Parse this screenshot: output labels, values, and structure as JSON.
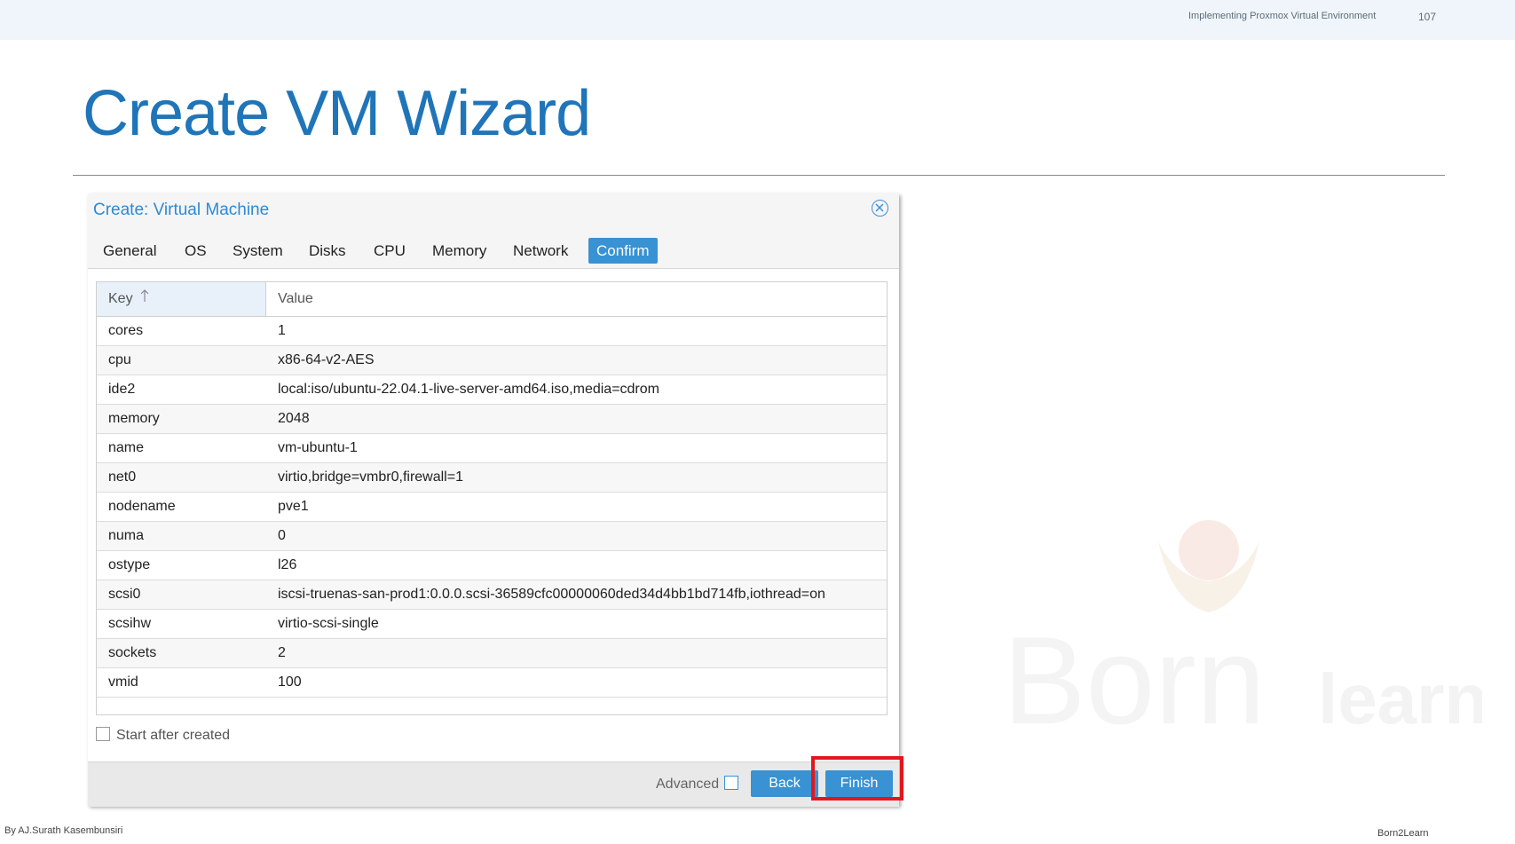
{
  "slide": {
    "header_text": "Implementing Proxmox Virtual Environment",
    "page_number": "107",
    "title": "Create VM Wizard",
    "footer_left": "By AJ.Surath Kasembunsiri",
    "footer_right": "Born2Learn",
    "watermark_text_1": "Born",
    "watermark_text_2": "learn"
  },
  "dialog": {
    "title": "Create: Virtual Machine",
    "close_icon": "close-circle-icon",
    "tabs": [
      {
        "label": "General"
      },
      {
        "label": "OS"
      },
      {
        "label": "System"
      },
      {
        "label": "Disks"
      },
      {
        "label": "CPU"
      },
      {
        "label": "Memory"
      },
      {
        "label": "Network"
      },
      {
        "label": "Confirm"
      }
    ],
    "active_tab": "Confirm",
    "grid": {
      "key_header": "Key",
      "sort_icon": "sort-ascending-icon",
      "value_header": "Value",
      "rows": [
        {
          "key": "cores",
          "value": "1"
        },
        {
          "key": "cpu",
          "value": "x86-64-v2-AES"
        },
        {
          "key": "ide2",
          "value": "local:iso/ubuntu-22.04.1-live-server-amd64.iso,media=cdrom"
        },
        {
          "key": "memory",
          "value": "2048"
        },
        {
          "key": "name",
          "value": "vm-ubuntu-1"
        },
        {
          "key": "net0",
          "value": "virtio,bridge=vmbr0,firewall=1"
        },
        {
          "key": "nodename",
          "value": "pve1"
        },
        {
          "key": "numa",
          "value": "0"
        },
        {
          "key": "ostype",
          "value": "l26"
        },
        {
          "key": "scsi0",
          "value": "iscsi-truenas-san-prod1:0.0.0.scsi-36589cfc00000060ded34d4bb1bd714fb,iothread=on"
        },
        {
          "key": "scsihw",
          "value": "virtio-scsi-single"
        },
        {
          "key": "sockets",
          "value": "2"
        },
        {
          "key": "vmid",
          "value": "100"
        }
      ]
    },
    "start_after_created": {
      "label": "Start after created",
      "checked": false
    },
    "advanced": {
      "label": "Advanced",
      "checked": false
    },
    "buttons": {
      "back": "Back",
      "finish": "Finish"
    },
    "colors": {
      "accent": "#3892d3",
      "title": "#1f75b8",
      "highlight": "#e3161d"
    }
  }
}
